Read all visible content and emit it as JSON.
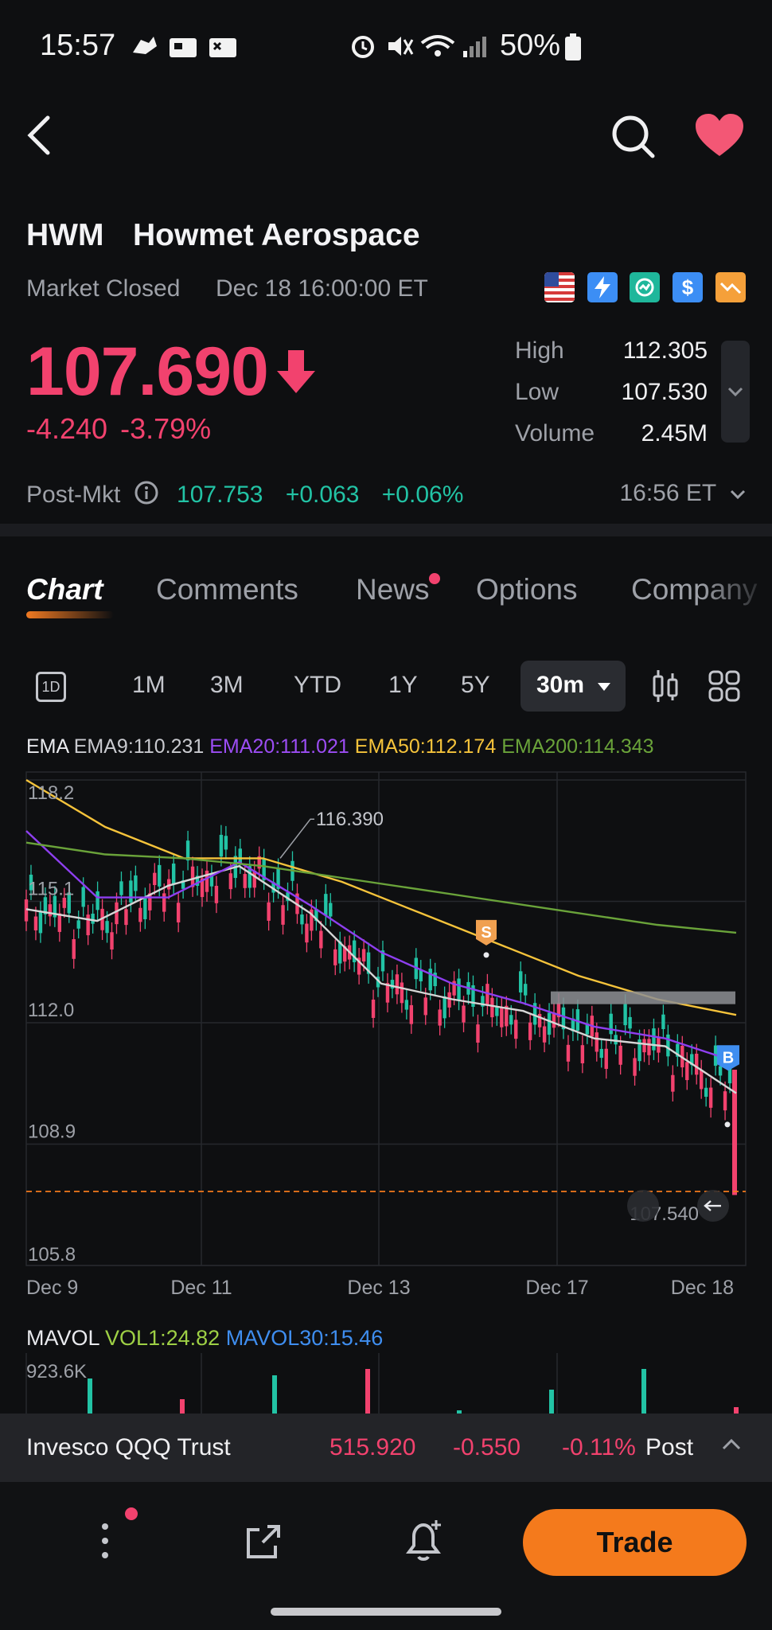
{
  "status_bar": {
    "time": "15:57",
    "battery": "50%"
  },
  "header": {
    "ticker": "HWM",
    "company_name": "Howmet Aerospace",
    "market_status": "Market Closed",
    "market_time": "Dec 18 16:00:00 ET"
  },
  "quote": {
    "price": "107.690",
    "change": "-4.240",
    "change_pct": "-3.79%",
    "high_label": "High",
    "high_value": "112.305",
    "low_label": "Low",
    "low_value": "107.530",
    "volume_label": "Volume",
    "volume_value": "2.45M",
    "post_label": "Post-Mkt",
    "post_price": "107.753",
    "post_change": "+0.063",
    "post_change_pct": "+0.06%",
    "post_time": "16:56 ET"
  },
  "tabs": [
    {
      "label": "Chart"
    },
    {
      "label": "Comments"
    },
    {
      "label": "News"
    },
    {
      "label": "Options"
    },
    {
      "label": "Company"
    }
  ],
  "ranges": [
    "1D",
    "1M",
    "3M",
    "YTD",
    "1Y",
    "5Y",
    "30m"
  ],
  "ema_legend": {
    "title": "EMA",
    "ema9": "EMA9:110.231",
    "ema20": "EMA20:111.021",
    "ema50": "EMA50:112.174",
    "ema200": "EMA200:114.343"
  },
  "chart_data": {
    "type": "line",
    "y_ticks": [
      "118.2",
      "115.1",
      "112.0",
      "108.9",
      "105.8"
    ],
    "ylim": [
      105.8,
      118.2
    ],
    "x_ticks": [
      "Dec 9",
      "Dec 11",
      "Dec 13",
      "Dec 17",
      "Dec 18"
    ],
    "high_annotation": "116.390",
    "current_line_label": "107.540",
    "markers": [
      "S",
      "B"
    ],
    "series": [
      {
        "name": "EMA9",
        "color": "#d6d6d6",
        "values": [
          114.9,
          114.6,
          115.5,
          116.0,
          114.8,
          113.0,
          112.6,
          112.3,
          111.6,
          111.4,
          110.2
        ]
      },
      {
        "name": "EMA20",
        "color": "#8e3ff0",
        "values": [
          116.9,
          115.2,
          115.2,
          116.1,
          115.0,
          113.8,
          113.0,
          112.5,
          111.9,
          111.6,
          111.0
        ]
      },
      {
        "name": "EMA50",
        "color": "#f5c33b",
        "values": [
          118.2,
          117.0,
          116.2,
          116.2,
          115.6,
          114.8,
          114.0,
          113.2,
          112.6,
          112.2
        ]
      },
      {
        "name": "EMA200",
        "color": "#6aa33a",
        "values": [
          116.6,
          116.3,
          116.2,
          116.0,
          115.7,
          115.4,
          115.1,
          114.8,
          114.5,
          114.3
        ]
      }
    ]
  },
  "volume": {
    "title": "MAVOL",
    "vol1": "VOL1:24.82",
    "mavol30": "MAVOL30:15.46",
    "max_label": "923.6K"
  },
  "ticker_bar": {
    "name": "Invesco QQQ Trust",
    "price": "515.920",
    "change": "-0.550",
    "change_pct": "-0.11%",
    "session": "Post"
  },
  "bottom": {
    "trade_label": "Trade"
  },
  "colors": {
    "down": "#f2426e",
    "up": "#22c3a5",
    "accent": "#f47a1c"
  }
}
